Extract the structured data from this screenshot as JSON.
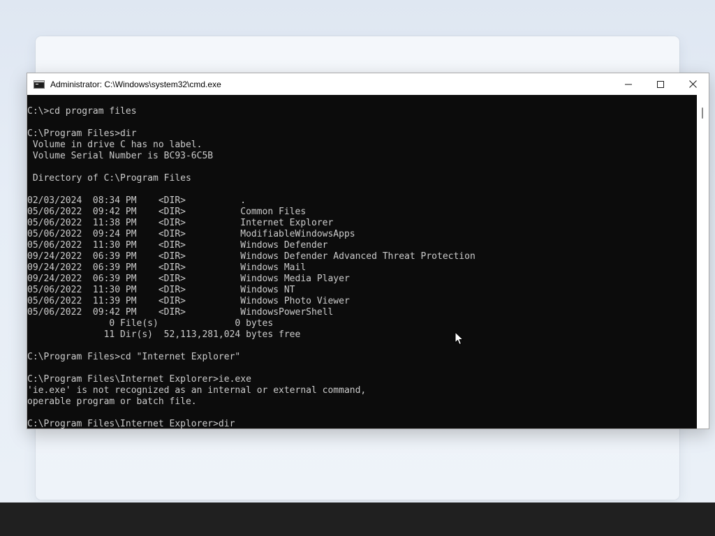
{
  "window": {
    "title": "Administrator: C:\\Windows\\system32\\cmd.exe",
    "icon": "cmd-icon",
    "controls": [
      "minimize-icon",
      "maximize-icon",
      "close-icon"
    ]
  },
  "console": {
    "lines": [
      "C:\\>cd program files",
      "",
      "C:\\Program Files>dir",
      " Volume in drive C has no label.",
      " Volume Serial Number is BC93-6C5B",
      "",
      " Directory of C:\\Program Files",
      "",
      "02/03/2024  08:34 PM    <DIR>          .",
      "05/06/2022  09:42 PM    <DIR>          Common Files",
      "05/06/2022  11:38 PM    <DIR>          Internet Explorer",
      "05/06/2022  09:24 PM    <DIR>          ModifiableWindowsApps",
      "05/06/2022  11:30 PM    <DIR>          Windows Defender",
      "09/24/2022  06:39 PM    <DIR>          Windows Defender Advanced Threat Protection",
      "09/24/2022  06:39 PM    <DIR>          Windows Mail",
      "09/24/2022  06:39 PM    <DIR>          Windows Media Player",
      "05/06/2022  11:30 PM    <DIR>          Windows NT",
      "05/06/2022  11:39 PM    <DIR>          Windows Photo Viewer",
      "05/06/2022  09:42 PM    <DIR>          WindowsPowerShell",
      "               0 File(s)              0 bytes",
      "              11 Dir(s)  52,113,281,024 bytes free",
      "",
      "C:\\Program Files>cd \"Internet Explorer\"",
      "",
      "C:\\Program Files\\Internet Explorer>ie.exe",
      "'ie.exe' is not recognized as an internal or external command,",
      "operable program or batch file.",
      "",
      "C:\\Program Files\\Internet Explorer>dir"
    ]
  },
  "colors": {
    "console_bg": "#0c0c0c",
    "console_fg": "#cccccc",
    "titlebar_bg": "#ffffff",
    "taskbar_bg": "#202020"
  }
}
